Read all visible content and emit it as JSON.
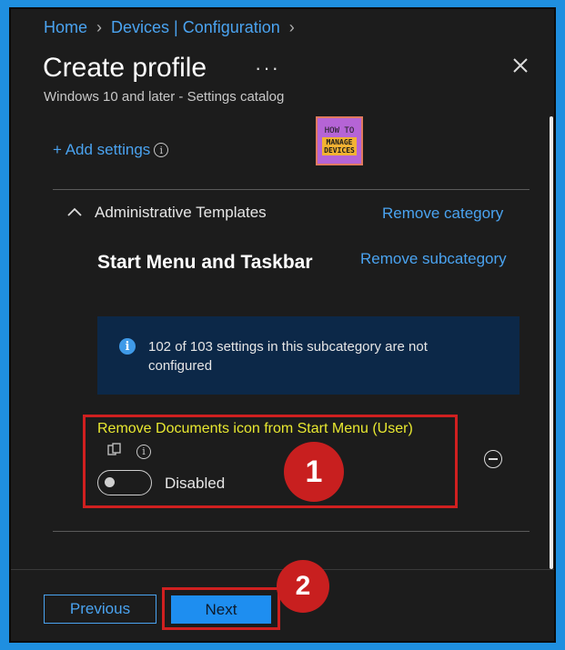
{
  "breadcrumb": {
    "items": [
      "Home",
      "Devices | Configuration"
    ]
  },
  "header": {
    "title": "Create profile",
    "more": "···",
    "subtitle": "Windows 10 and later - Settings catalog"
  },
  "add_settings": {
    "label": "+ Add settings"
  },
  "logo": {
    "line1": "HOW TO",
    "line2": "MANAGE",
    "line3": "DEVICES"
  },
  "category": {
    "label": "Administrative Templates",
    "remove_label": "Remove category",
    "subcategory_title": "Start Menu and Taskbar",
    "remove_subcategory_label": "Remove subcategory"
  },
  "info_banner": {
    "icon": "info-icon",
    "text": "102 of 103 settings in this subcategory are not configured"
  },
  "setting": {
    "name": "Remove Documents icon from Start Menu (User)",
    "toggle_label": "Disabled",
    "toggle_on": false,
    "name_color": "#e8e830"
  },
  "annotations": {
    "badge1": "1",
    "badge2": "2",
    "color": "#c81f1f"
  },
  "footer": {
    "previous_label": "Previous",
    "next_label": "Next"
  },
  "colors": {
    "accent": "#4aa3f0",
    "background": "#1c1c1c",
    "primary_button": "#1e8ef0"
  }
}
